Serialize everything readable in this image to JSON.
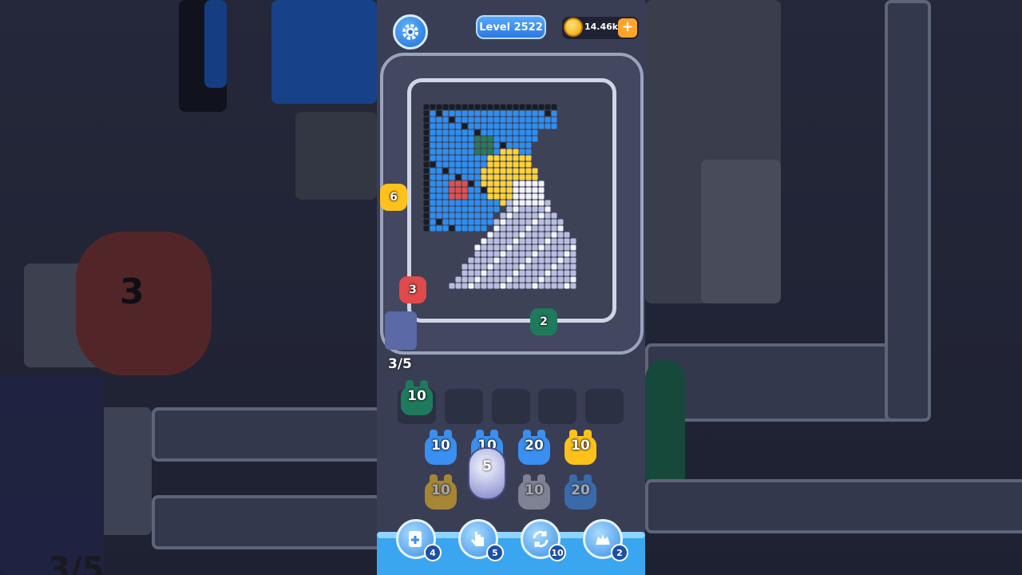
{
  "header": {
    "level_label": "Level 2522",
    "coins": "14.46k",
    "coin_plus": "+"
  },
  "conveyor": {
    "pieces": [
      {
        "count": "6",
        "color": "#ffc21a"
      },
      {
        "count": "3",
        "color": "#e04a4a"
      },
      {
        "count": "2",
        "color": "#1f7a5c"
      }
    ]
  },
  "progress_text": "3/5",
  "slots": [
    {
      "count": "10",
      "color": "#1f7a5c",
      "filled": true
    },
    {
      "filled": false
    },
    {
      "filled": false
    },
    {
      "filled": false
    },
    {
      "filled": false
    }
  ],
  "shooters": {
    "row1": [
      {
        "count": "10",
        "color": "#3b8ff0"
      },
      {
        "count": "10",
        "color": "#3b8ff0"
      },
      {
        "count": "20",
        "color": "#3b8ff0"
      },
      {
        "count": "10",
        "color": "#ffc21a"
      }
    ],
    "row2": [
      {
        "count": "10",
        "color": "#ffc21a"
      },
      {
        "count": "5",
        "color": "#e3e6f5"
      },
      {
        "count": "10",
        "color": "#b7bbc8"
      },
      {
        "count": "20",
        "color": "#3b8ff0"
      }
    ]
  },
  "boosters": [
    {
      "icon": "add-slot-icon",
      "count": "4"
    },
    {
      "icon": "hand-icon",
      "count": "5"
    },
    {
      "icon": "shuffle-icon",
      "count": "10"
    },
    {
      "icon": "magnet-icon",
      "count": "2"
    }
  ],
  "colors": {
    "blue": "#2e8ef0",
    "yellow": "#ffd23a",
    "white": "#f2f3fa",
    "lavender": "#b9bde0",
    "dark": "#1a1c24",
    "red": "#e05050",
    "green": "#2a7a5a"
  }
}
